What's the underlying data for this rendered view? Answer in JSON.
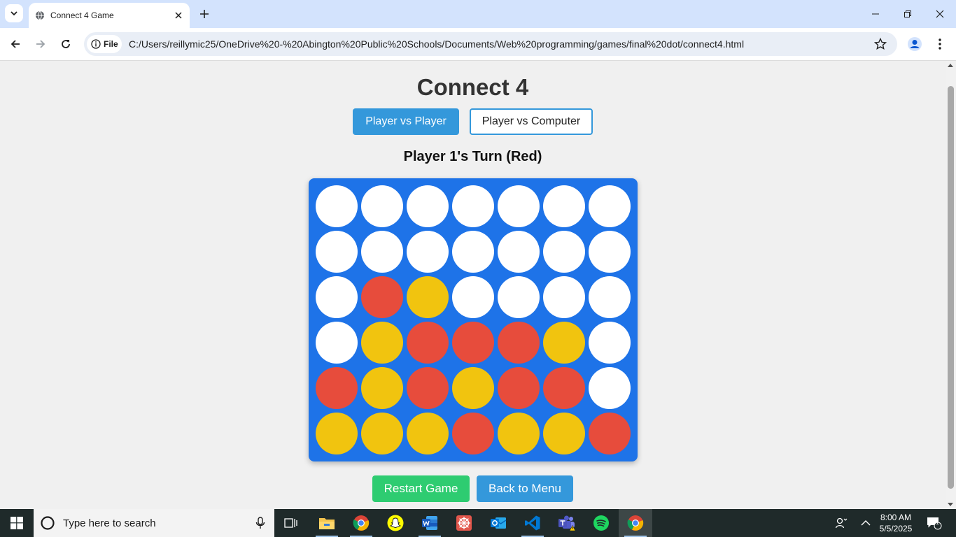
{
  "browser": {
    "tab_title": "Connect 4 Game",
    "site_chip": "File",
    "url": "C:/Users/reillymic25/OneDrive%20-%20Abington%20Public%20Schools/Documents/Web%20programming/games/final%20dot/connect4.html"
  },
  "game": {
    "title": "Connect 4",
    "mode_pvp": "Player vs Player",
    "mode_pvc": "Player vs Computer",
    "turn_text": "Player 1's Turn (Red)",
    "restart_label": "Restart Game",
    "menu_label": "Back to Menu",
    "colors": {
      "board": "#1e73e8",
      "empty": "#ffffff",
      "red": "#e74c3c",
      "yellow": "#f1c40f"
    },
    "board": [
      [
        "empty",
        "empty",
        "empty",
        "empty",
        "empty",
        "empty",
        "empty"
      ],
      [
        "empty",
        "empty",
        "empty",
        "empty",
        "empty",
        "empty",
        "empty"
      ],
      [
        "empty",
        "red",
        "yellow",
        "empty",
        "empty",
        "empty",
        "empty"
      ],
      [
        "empty",
        "yellow",
        "red",
        "red",
        "red",
        "yellow",
        "empty"
      ],
      [
        "red",
        "yellow",
        "red",
        "yellow",
        "red",
        "red",
        "empty"
      ],
      [
        "yellow",
        "yellow",
        "yellow",
        "red",
        "yellow",
        "yellow",
        "red"
      ]
    ]
  },
  "taskbar": {
    "search_placeholder": "Type here to search",
    "time": "8:00 AM",
    "date": "5/5/2025",
    "notification_count": "1",
    "apps": [
      "task-view",
      "file-explorer",
      "chrome",
      "snapchat",
      "word",
      "app-red",
      "outlook",
      "vscode",
      "teams",
      "spotify",
      "chrome-active"
    ]
  }
}
